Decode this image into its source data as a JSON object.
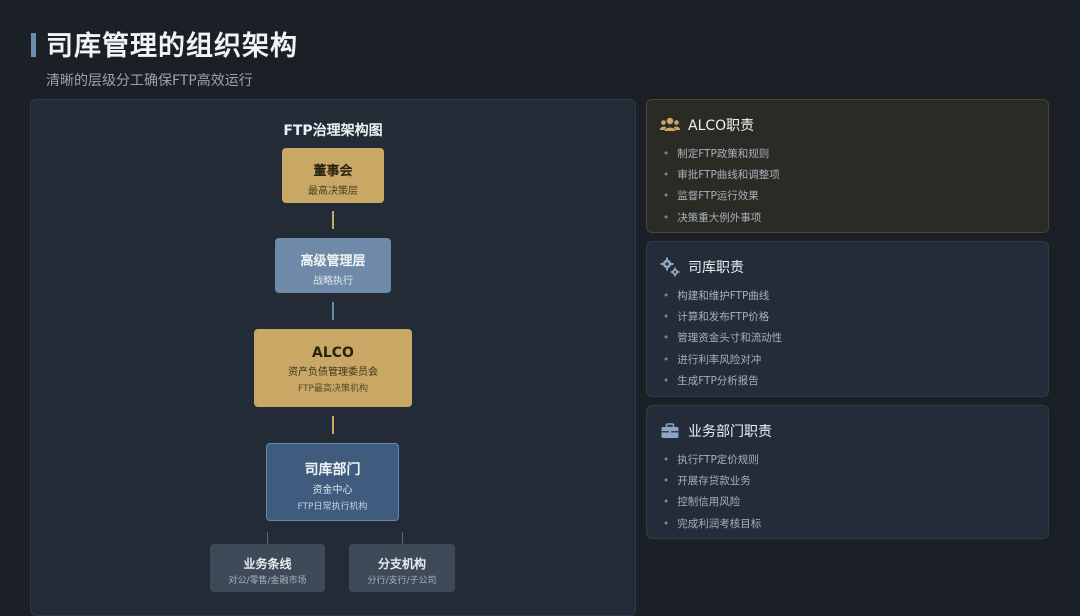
{
  "header": {
    "title": "司库管理的组织架构",
    "subtitle": "清晰的层级分工确保FTP高效运行"
  },
  "diagram": {
    "title": "FTP治理架构图",
    "nodes": {
      "board": {
        "title": "董事会",
        "sub": "最高决策层"
      },
      "senior": {
        "title": "高级管理层",
        "sub": "战略执行"
      },
      "alco": {
        "title": "ALCO",
        "sub": "资产负债管理委员会",
        "sub2": "FTP最高决策机构"
      },
      "treasury": {
        "title": "司库部门",
        "sub": "资金中心",
        "sub2": "FTP日常执行机构"
      },
      "business": {
        "title": "业务条线",
        "sub": "对公/零售/金融市场"
      },
      "branch": {
        "title": "分支机构",
        "sub": "分行/支行/子公司"
      }
    }
  },
  "cards": {
    "alco": {
      "icon": "users-icon",
      "title": "ALCO职责",
      "items": [
        "制定FTP政策和规则",
        "审批FTP曲线和调整项",
        "监督FTP运行效果",
        "决策重大例外事项"
      ]
    },
    "treasury": {
      "icon": "gears-icon",
      "title": "司库职责",
      "items": [
        "构建和维护FTP曲线",
        "计算和发布FTP价格",
        "管理资金头寸和流动性",
        "进行利率风险对冲",
        "生成FTP分析报告"
      ]
    },
    "business": {
      "icon": "briefcase-icon",
      "title": "业务部门职责",
      "items": [
        "执行FTP定价规则",
        "开展存贷款业务",
        "控制信用风险",
        "完成利润考核目标"
      ]
    }
  },
  "colors": {
    "gold": "#c9a866",
    "steel_blue": "#6f8aa8",
    "navy": "#3f5b7e",
    "slate": "#3e4a58"
  }
}
